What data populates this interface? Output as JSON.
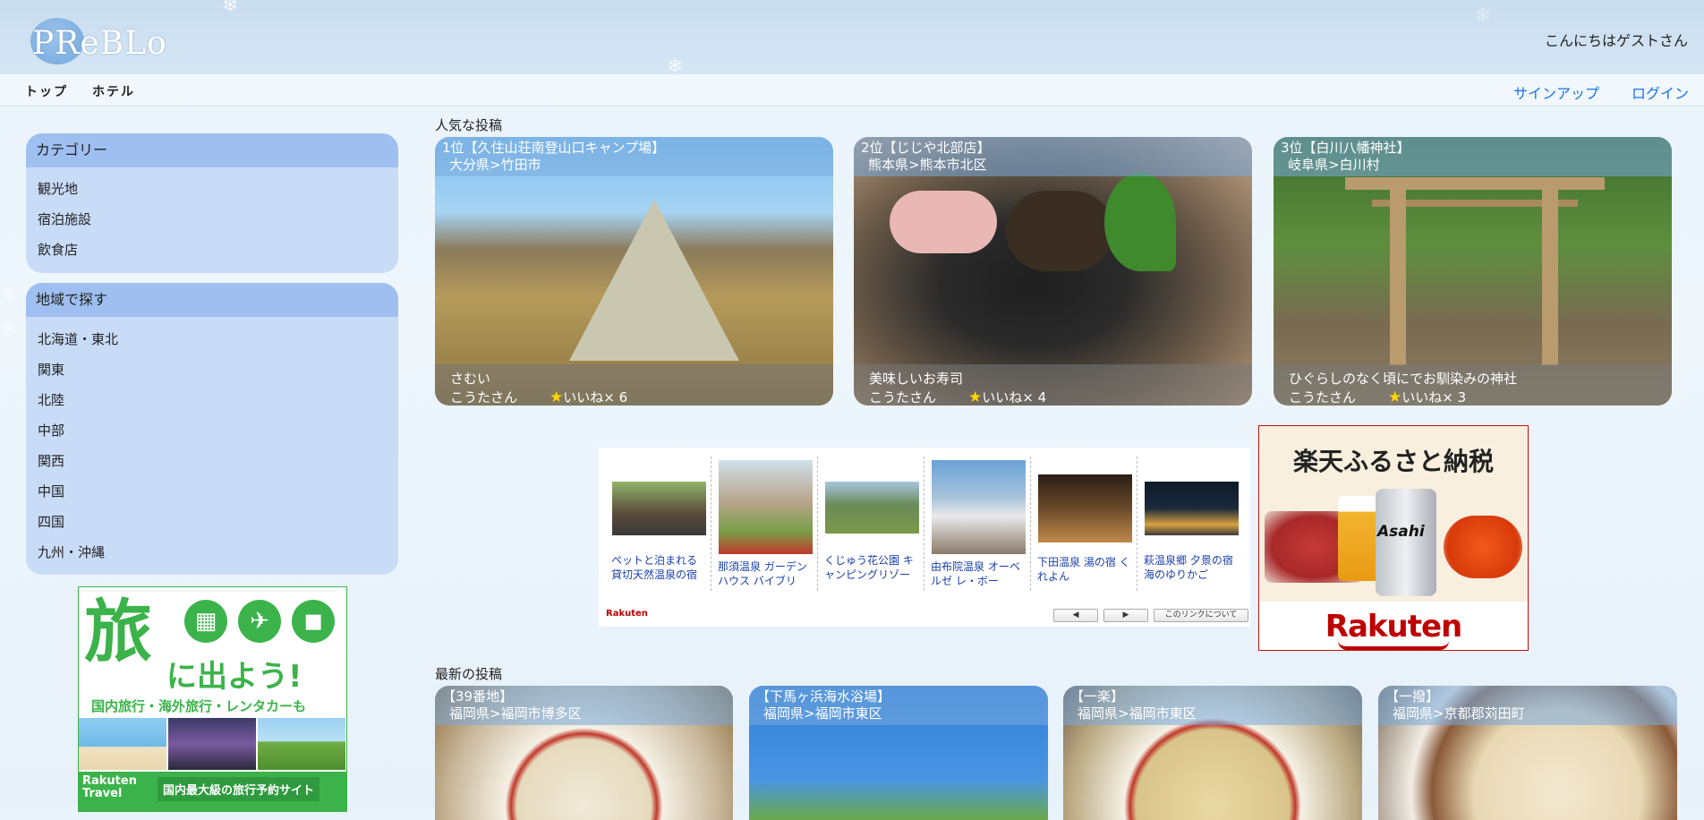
{
  "header": {
    "logo": "PReBLo",
    "greeting": "こんにちはゲストさん"
  },
  "nav": {
    "left": [
      "トップ",
      "ホテル"
    ],
    "signup": "サインアップ",
    "login": "ログイン"
  },
  "sidebar": {
    "categories": {
      "title": "カテゴリー",
      "items": [
        "観光地",
        "宿泊施設",
        "飲食店"
      ]
    },
    "regions": {
      "title": "地域で探す",
      "items": [
        "北海道・東北",
        "関東",
        "北陸",
        "中部",
        "関西",
        "中国",
        "四国",
        "九州・沖縄"
      ]
    }
  },
  "travel_ad": {
    "big": "旅",
    "sub": "に出よう!",
    "line": "国内旅行・海外旅行・レンタカーも",
    "brand": "Rakuten\nTravel",
    "tag": "国内最大級の旅行予約サイト"
  },
  "popular": {
    "title": "人気な投稿",
    "posts": [
      {
        "rank": "1位【久住山荘南登山口キャンプ場】",
        "area": "大分県>竹田市",
        "caption": "さむい",
        "user": "こうたさん",
        "likes": "いいね× 6"
      },
      {
        "rank": "2位【じじや北部店】",
        "area": "熊本県>熊本市北区",
        "caption": "美味しいお寿司",
        "user": "こうたさん",
        "likes": "いいね× 4"
      },
      {
        "rank": "3位【白川八幡神社】",
        "area": "岐阜県>白川村",
        "caption": "ひぐらしのなく頃にでお馴染みの神社",
        "user": "こうたさん",
        "likes": "いいね× 3"
      }
    ]
  },
  "rakuten_widget": {
    "items": [
      "ペットと泊まれる貸切天然温泉の宿",
      "那須温泉 ガーデンハウス バイブリ",
      "くじゅう花公園 キャンピングリゾート",
      "由布院温泉 オーベルゼ レ・ボー",
      "下田温泉 湯の宿 くれよん",
      "萩温泉郷 夕景の宿 海のゆりかご"
    ],
    "logo": "Rakuten",
    "prev": "◀",
    "next": "▶",
    "about": "このリンクについて"
  },
  "furusato_ad": {
    "title": "楽天ふるさと納税",
    "brand": "Rakuten",
    "beer": "Asahi"
  },
  "latest": {
    "title": "最新の投稿",
    "posts": [
      {
        "name": "【39番地】",
        "area": "福岡県>福岡市博多区"
      },
      {
        "name": "【下馬ヶ浜海水浴場】",
        "area": "福岡県>福岡市東区"
      },
      {
        "name": "【一楽】",
        "area": "福岡県>福岡市東区"
      },
      {
        "name": "【一撥】",
        "area": "福岡県>京都郡苅田町"
      }
    ]
  },
  "colors": {
    "accent_link": "#1a73e8",
    "sidebar_box": "#c8dcf8",
    "sidebar_head": "#9ebff0",
    "ad_green": "#3bb34a",
    "rakuten_red": "#bf0000"
  }
}
